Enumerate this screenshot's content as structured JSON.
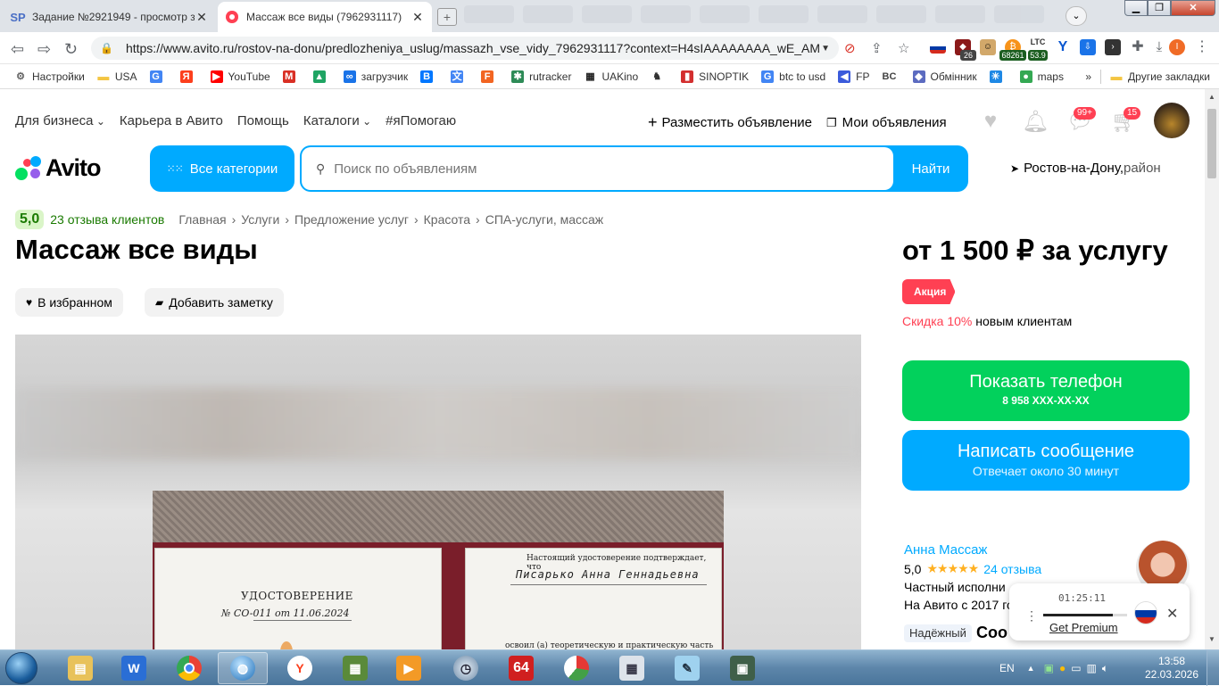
{
  "browser": {
    "tabs": [
      {
        "title": "Задание №2921949 - просмотр з",
        "favicon": "SP"
      },
      {
        "title": "Массаж все виды (7962931117)",
        "favicon": "avito-icon"
      }
    ],
    "url_main": "https://www.avito.ru/rostov-na-donu/predlozheniya_uslug/massazh_vse_vidy_7962931117?context=H4sIAAAAAAAA_wE_AMD",
    "url_tail": "...",
    "extensions": {
      "badge1": "26",
      "badge2": "68261",
      "ltc": "LTC",
      "ltc_val": "53.9",
      "profile": "I"
    }
  },
  "bookmarks": [
    {
      "label": "Настройки",
      "icon": "gear-icon",
      "color": "#666666"
    },
    {
      "label": "USA",
      "icon": "folder-icon",
      "color": "#f4c542"
    },
    {
      "label": "",
      "icon": "google-icon",
      "color": "#4285f4"
    },
    {
      "label": "",
      "icon": "yandex-icon",
      "color": "#fc3f1d"
    },
    {
      "label": "YouTube",
      "icon": "youtube-icon",
      "color": "#ff0000"
    },
    {
      "label": "",
      "icon": "gmail-icon",
      "color": "#d93025"
    },
    {
      "label": "",
      "icon": "drive-icon",
      "color": "#1fa463"
    },
    {
      "label": "загрузчик",
      "icon": "loader-icon",
      "color": "#1a73e8"
    },
    {
      "label": "",
      "icon": "vk-icon",
      "color": "#0077ff"
    },
    {
      "label": "",
      "icon": "translate-icon",
      "color": "#4285f4"
    },
    {
      "label": "",
      "icon": "f-icon",
      "color": "#f26522"
    },
    {
      "label": "rutracker",
      "icon": "rutracker-icon",
      "color": "#2e8b57"
    },
    {
      "label": "UAKino",
      "icon": "uakino-icon",
      "color": "#222222"
    },
    {
      "label": "",
      "icon": "chess-icon",
      "color": "#333333"
    },
    {
      "label": "SINOPTIK",
      "icon": "thermometer-icon",
      "color": "#d32f2f"
    },
    {
      "label": "btc to usd",
      "icon": "google-icon",
      "color": "#4285f4"
    },
    {
      "label": "FP",
      "icon": "fp-icon",
      "color": "#3b5bdb"
    },
    {
      "label": "",
      "icon": "bc-icon",
      "color": "#444444"
    },
    {
      "label": "Обмінник",
      "icon": "exchange-icon",
      "color": "#5c6bc0"
    },
    {
      "label": "",
      "icon": "star-icon",
      "color": "#1e88e5"
    },
    {
      "label": "maps",
      "icon": "maps-icon",
      "color": "#34a853"
    }
  ],
  "bookmarks_more": "»",
  "bookmarks_other": "Другие закладки",
  "header": {
    "nav": [
      "Для бизнеса",
      "Карьера в Авито",
      "Помощь",
      "Каталоги",
      "#яПомогаю"
    ],
    "post_ad": "Разместить объявление",
    "my_ads": "Мои объявления",
    "msg_badge": "99+",
    "cart_badge": "15",
    "logo": "Avito",
    "all_categories": "Все категории",
    "search_placeholder": "Поиск по объявлениям",
    "search_button": "Найти",
    "location": "Ростов-на-Дону,",
    "location_suffix": " район"
  },
  "listing": {
    "score": "5,0",
    "reviews_link": "23 отзыва клиентов",
    "breadcrumbs": [
      "Главная",
      "Услуги",
      "Предложение услуг",
      "Красота",
      "СПА-услуги, массаж"
    ],
    "title": "Массаж все виды",
    "fav_button": "В избранном",
    "note_button": "Добавить заметку",
    "photo": {
      "doc_title": "УДОСТОВЕРЕНИЕ",
      "doc_number": "№ CO-011 от 11.06.2024",
      "doc_confirm": "Настоящий удостоверение подтверждает, что",
      "doc_name": "Писарько Анна Геннадьевна",
      "doc_course": "освоил (а) теоретическую и практическую часть курса"
    }
  },
  "sidebar": {
    "price": "от 1 500 ₽ за услугу",
    "promo": "Акция",
    "discount": "Скидка 10%",
    "discount_tail": " новым клиентам",
    "phone_button": "Показать телефон",
    "phone_number": "8 958 XXX-XX-XX",
    "message_button": "Написать сообщение",
    "message_sub": "Отвечает около 30 минут",
    "seller_name": "Анна Массаж",
    "seller_score": "5,0",
    "seller_reviews": "24 отзыва",
    "seller_type": "Частный исполни",
    "seller_since": "На Авито с 2017 го",
    "trust": "Надёжный",
    "coo": "Соо"
  },
  "vpn_widget": {
    "timer": "01:25:11",
    "premium": "Get Premium",
    "progress": 0.83
  },
  "taskbar": {
    "apps": [
      "explorer",
      "winzip",
      "chrome",
      "globe",
      "yandex",
      "cpu-z",
      "player",
      "clock",
      "64",
      "chart",
      "calculator",
      "notepad",
      "monitor"
    ],
    "lang": "EN",
    "time": "13:58",
    "date": "22.03.2026"
  },
  "colors": {
    "avito_blue": "#00aaff",
    "avito_green": "#02d15c",
    "avito_red": "#ff4053"
  }
}
